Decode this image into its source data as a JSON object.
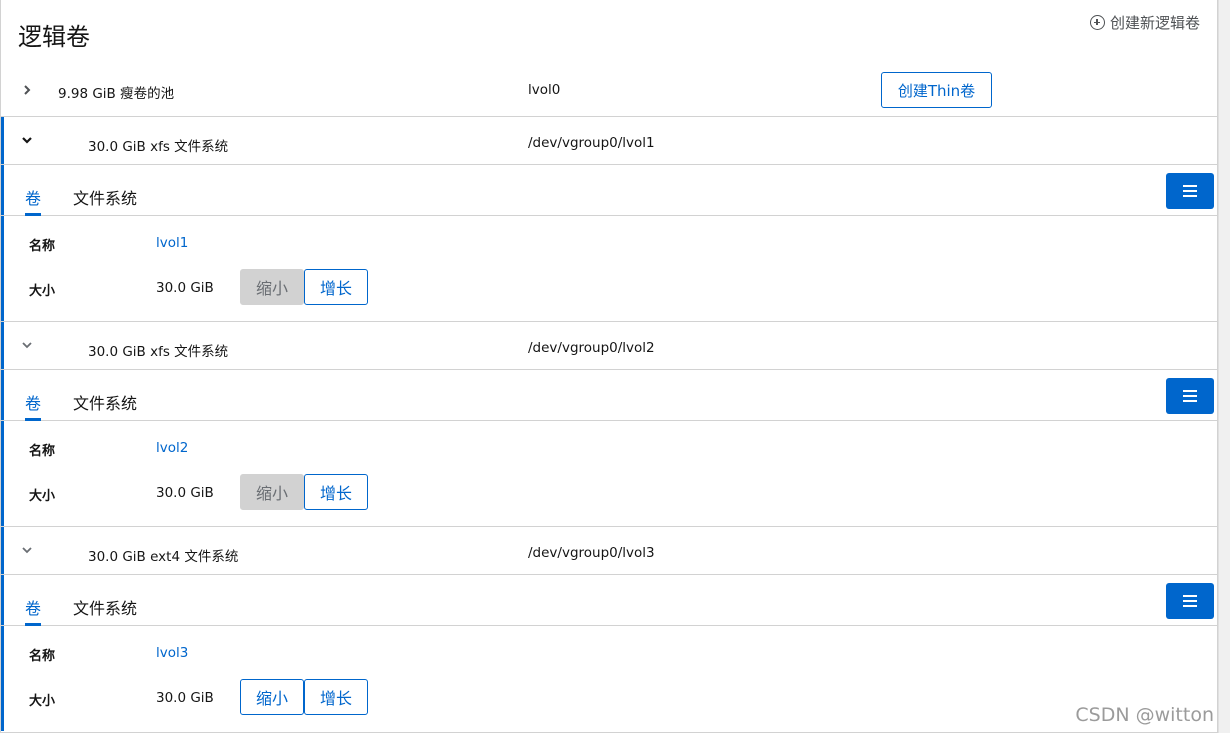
{
  "header": {
    "title": "逻辑卷",
    "create_lv_label": "创建新逻辑卷"
  },
  "pool": {
    "desc": "9.98 GiB 瘦卷的池",
    "name": "lvol0",
    "create_thin_label": "创建Thin卷"
  },
  "volumes": [
    {
      "desc": "30.0 GiB xfs 文件系统",
      "device": "/dev/vgroup0/lvol1",
      "tab_volume": "卷",
      "tab_fs": "文件系统",
      "name_label": "名称",
      "name_value": "lvol1",
      "size_label": "大小",
      "size_value": "30.0 GiB",
      "shrink_label": "缩小",
      "grow_label": "增长",
      "shrink_enabled": false
    },
    {
      "desc": "30.0 GiB xfs 文件系统",
      "device": "/dev/vgroup0/lvol2",
      "tab_volume": "卷",
      "tab_fs": "文件系统",
      "name_label": "名称",
      "name_value": "lvol2",
      "size_label": "大小",
      "size_value": "30.0 GiB",
      "shrink_label": "缩小",
      "grow_label": "增长",
      "shrink_enabled": false
    },
    {
      "desc": "30.0 GiB ext4 文件系统",
      "device": "/dev/vgroup0/lvol3",
      "tab_volume": "卷",
      "tab_fs": "文件系统",
      "name_label": "名称",
      "name_value": "lvol3",
      "size_label": "大小",
      "size_value": "30.0 GiB",
      "shrink_label": "缩小",
      "grow_label": "增长",
      "shrink_enabled": true
    }
  ],
  "watermark": "CSDN @witton",
  "colors": {
    "accent": "#0066cc",
    "border": "#d2d2d2",
    "disabled_bg": "#d2d2d2"
  },
  "icons": {
    "collapsed": "chevron-right-icon",
    "expanded": "chevron-down-icon",
    "create": "plus-circle-icon",
    "menu": "hamburger-menu-icon"
  }
}
